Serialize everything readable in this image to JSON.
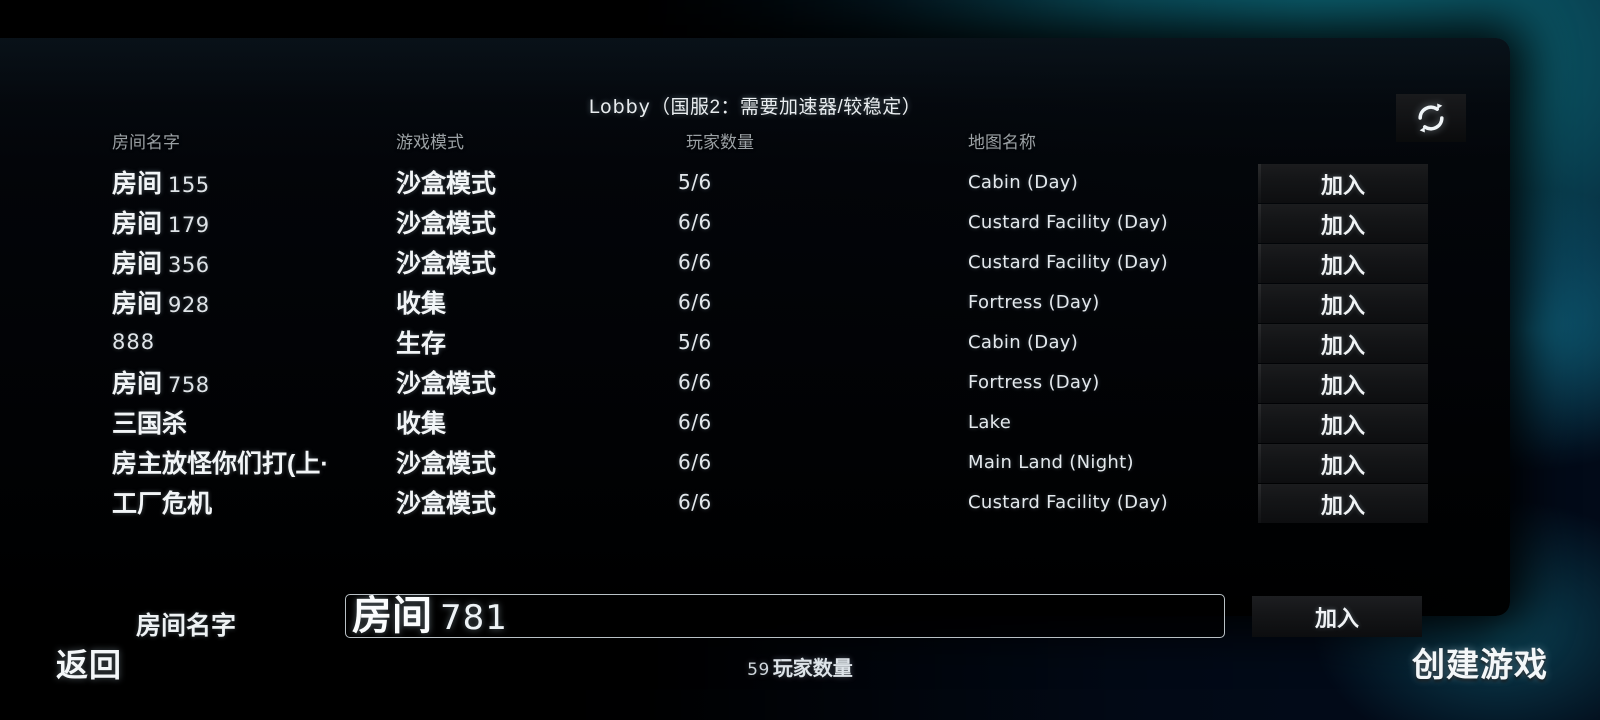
{
  "window": {
    "title": "Lobby（国服2：需要加速器/较稳定）",
    "title_latin": "Lobby",
    "title_cjk": "（国服2：需要加速器/较稳定）"
  },
  "toolbar": {
    "refresh_icon": "refresh-icon"
  },
  "table": {
    "headers": {
      "name": "房间名字",
      "mode": "游戏模式",
      "players": "玩家数量",
      "map": "地图名称"
    },
    "join_label": "加入",
    "rows": [
      {
        "name_cjk": "房间",
        "name_num": "155",
        "name_full": "房间 155",
        "mode": "沙盒模式",
        "players": "5/6",
        "map": "Cabin (Day)",
        "join": "加入"
      },
      {
        "name_cjk": "房间",
        "name_num": "179",
        "name_full": "房间 179",
        "mode": "沙盒模式",
        "players": "6/6",
        "map": "Custard Facility (Day)",
        "join": "加入"
      },
      {
        "name_cjk": "房间",
        "name_num": "356",
        "name_full": "房间 356",
        "mode": "沙盒模式",
        "players": "6/6",
        "map": "Custard Facility (Day)",
        "join": "加入"
      },
      {
        "name_cjk": "房间",
        "name_num": "928",
        "name_full": "房间 928",
        "mode": "收集",
        "players": "6/6",
        "map": "Fortress (Day)",
        "join": "加入"
      },
      {
        "name_cjk": "",
        "name_num": "888",
        "name_full": "888",
        "mode": "生存",
        "players": "5/6",
        "map": "Cabin (Day)",
        "join": "加入"
      },
      {
        "name_cjk": "房间",
        "name_num": "758",
        "name_full": "房间 758",
        "mode": "沙盒模式",
        "players": "6/6",
        "map": "Fortress (Day)",
        "join": "加入"
      },
      {
        "name_cjk": "三国杀",
        "name_num": "",
        "name_full": "三国杀",
        "mode": "收集",
        "players": "6/6",
        "map": "Lake",
        "join": "加入"
      },
      {
        "name_cjk": "房主放怪你们打(上·",
        "name_num": "",
        "name_full": "房主放怪你们打(上·",
        "mode": "沙盒模式",
        "players": "6/6",
        "map": "Main Land (Night)",
        "join": "加入"
      },
      {
        "name_cjk": "工厂危机",
        "name_num": "",
        "name_full": "工厂危机",
        "mode": "沙盒模式",
        "players": "6/6",
        "map": "Custard Facility (Day)",
        "join": "加入"
      }
    ]
  },
  "create_field": {
    "label": "房间名字",
    "value_cjk": "房间",
    "value_num": "781",
    "value_full": "房间 781",
    "join_label": "加入"
  },
  "footer": {
    "back_label": "返回",
    "player_count_num": "59",
    "player_count_label": "玩家数量",
    "create_label": "创建游戏"
  },
  "colors": {
    "panel_bg": "#05080d",
    "text_primary": "#f2f5f7",
    "text_muted": "#9aa0a4",
    "button_bg": "#151618",
    "backdrop_teal": "#0d6a78",
    "backdrop_blue": "#101a6b"
  }
}
